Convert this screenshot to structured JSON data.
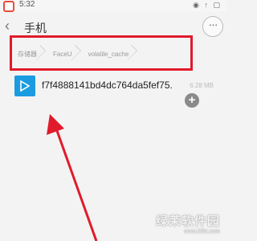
{
  "status_bar": {
    "time": "5:32",
    "icons": "◉ ↑ ▢"
  },
  "title_bar": {
    "title": "手机",
    "more_label": "···"
  },
  "breadcrumb": {
    "items": [
      "存储器",
      "FaceU",
      "volatile_cache"
    ]
  },
  "file_list": [
    {
      "name": "f7f4888141bd4dc764da5fef75.",
      "size": "6.28 MB"
    }
  ],
  "add_button_label": "+",
  "watermark": {
    "main": "绿茉软件园",
    "sub": "www.33lc.com"
  },
  "colors": {
    "highlight": "#e01b2b",
    "file_icon": "#1b9be0"
  }
}
